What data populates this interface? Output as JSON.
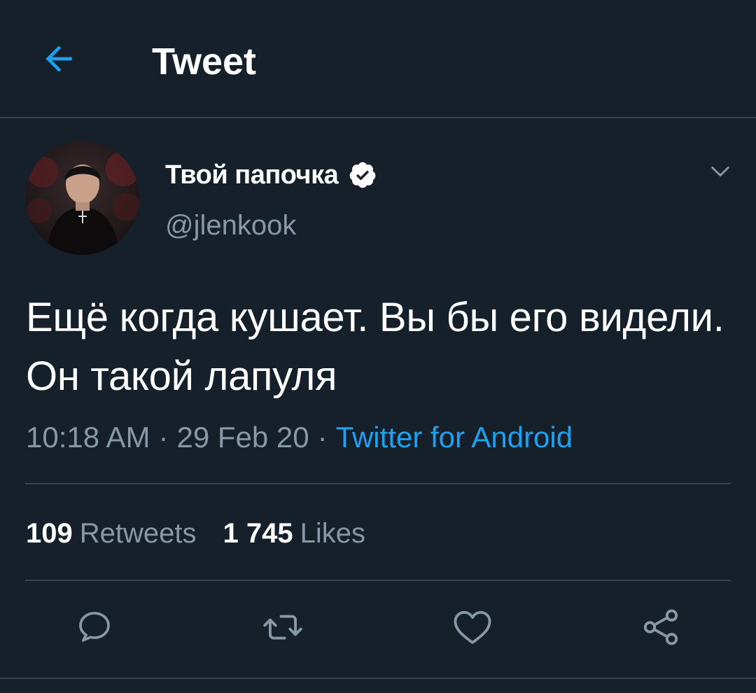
{
  "header": {
    "title": "Tweet",
    "back_icon": "arrow-left-icon"
  },
  "author": {
    "display_name": "Твой папочка",
    "handle": "@jlenkook",
    "verified": true
  },
  "tweet": {
    "text": "Ещё когда кушает. Вы бы его видели. Он такой лапуля",
    "time": "10:18 AM",
    "date": "29 Feb 20",
    "separator": "·",
    "source": "Twitter for Android"
  },
  "stats": {
    "retweets_count": "109",
    "retweets_label": "Retweets",
    "likes_count": "1 745",
    "likes_label": "Likes"
  },
  "actions": [
    {
      "name": "reply",
      "icon": "reply-icon"
    },
    {
      "name": "retweet",
      "icon": "retweet-icon"
    },
    {
      "name": "like",
      "icon": "heart-icon"
    },
    {
      "name": "share",
      "icon": "share-icon"
    }
  ],
  "colors": {
    "background": "#15202b",
    "accent": "#1da1f2",
    "secondary_text": "#8899a6",
    "divider": "#38444d"
  }
}
